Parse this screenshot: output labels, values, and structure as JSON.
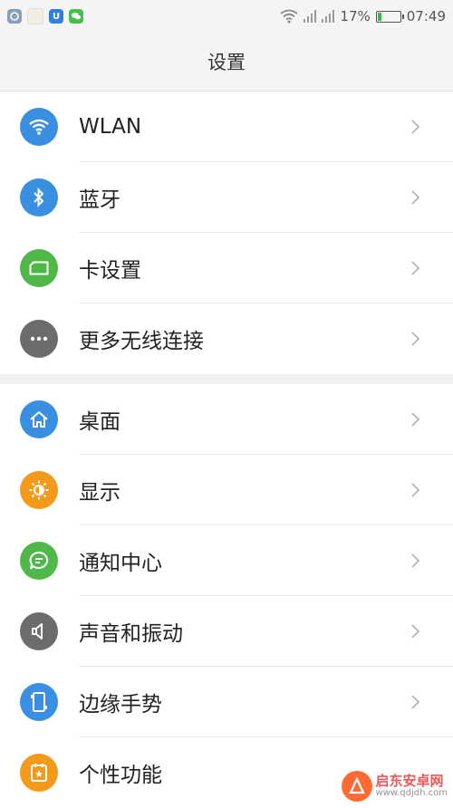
{
  "status": {
    "battery_percent": "17%",
    "battery_level": 0.17,
    "time": "07:49",
    "notification_icons": [
      "bug-app-icon",
      "gallery-icon",
      "u-app-icon",
      "wechat-icon"
    ]
  },
  "header": {
    "title": "设置"
  },
  "groups": [
    {
      "items": [
        {
          "label": "WLAN",
          "icon": "wifi-icon",
          "color": "#3a8fe0"
        },
        {
          "label": "蓝牙",
          "icon": "bluetooth-icon",
          "color": "#3a8fe0"
        },
        {
          "label": "卡设置",
          "icon": "sim-card-icon",
          "color": "#4fb848"
        },
        {
          "label": "更多无线连接",
          "icon": "more-dots-icon",
          "color": "#6c6c6c"
        }
      ]
    },
    {
      "items": [
        {
          "label": "桌面",
          "icon": "home-icon",
          "color": "#3a8fe0"
        },
        {
          "label": "显示",
          "icon": "brightness-icon",
          "color": "#f39a1a"
        },
        {
          "label": "通知中心",
          "icon": "message-icon",
          "color": "#4fb848"
        },
        {
          "label": "声音和振动",
          "icon": "speaker-icon",
          "color": "#6c6c6c"
        },
        {
          "label": "边缘手势",
          "icon": "edge-gesture-icon",
          "color": "#3a8fe0"
        },
        {
          "label": "个性功能",
          "icon": "personal-feature-icon",
          "color": "#f39a1a"
        }
      ]
    }
  ],
  "watermark": {
    "name": "启东安卓网",
    "url": "www.qdjdh.com"
  }
}
